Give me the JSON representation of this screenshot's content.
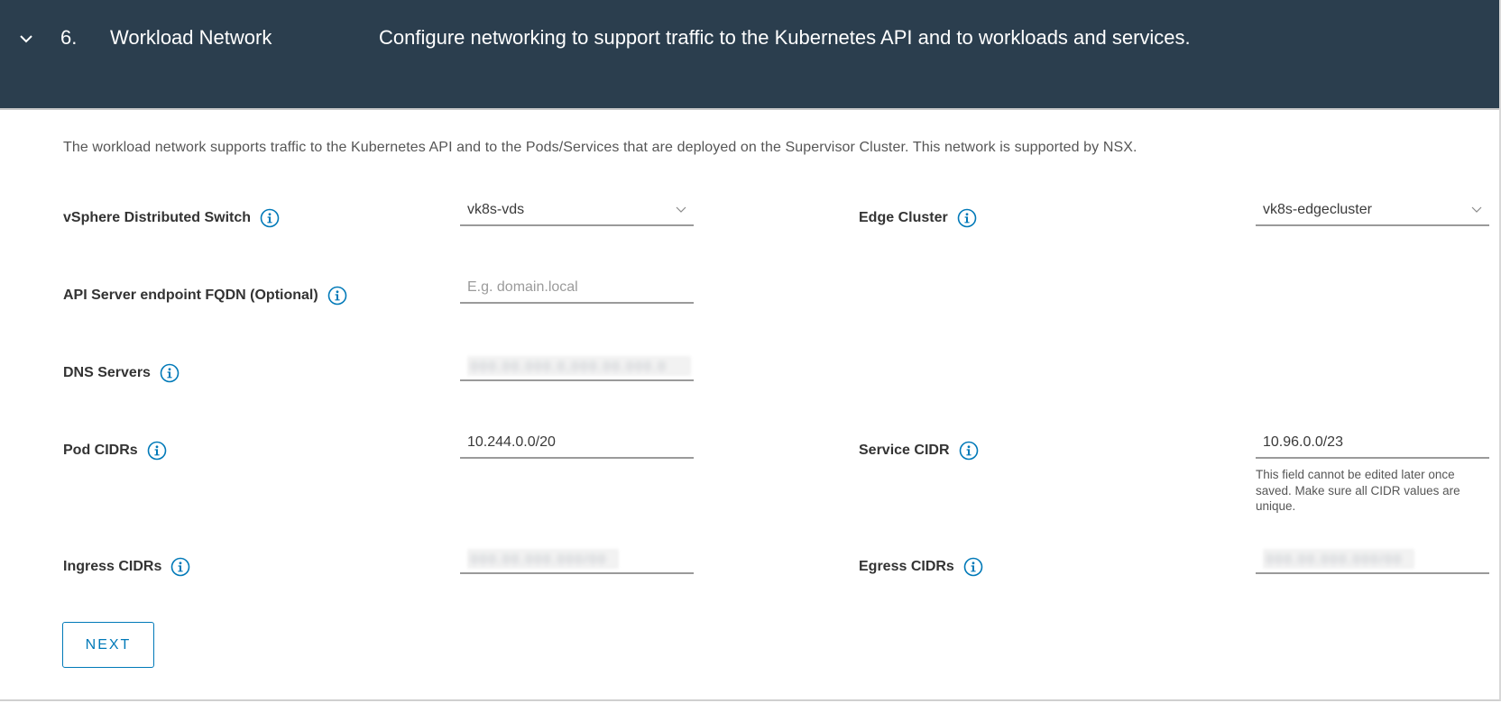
{
  "header": {
    "step_number": "6.",
    "title": "Workload Network",
    "description": "Configure networking to support traffic to the Kubernetes API and to workloads and services.",
    "expanded_icon": "chevron-down-icon"
  },
  "intro": "The workload network supports traffic to the Kubernetes API and to the Pods/Services that are deployed on the Supervisor Cluster. This network is supported by NSX.",
  "fields": {
    "vds": {
      "label": "vSphere Distributed Switch",
      "value": "vk8s-vds",
      "type": "select"
    },
    "edge_cluster": {
      "label": "Edge Cluster",
      "value": "vk8s-edgecluster",
      "type": "select"
    },
    "api_fqdn": {
      "label": "API Server endpoint FQDN (Optional)",
      "value": "",
      "placeholder": "E.g. domain.local",
      "type": "text"
    },
    "dns": {
      "label": "DNS Servers",
      "value": "[redacted]",
      "type": "text",
      "redacted": true
    },
    "pod_cidrs": {
      "label": "Pod CIDRs",
      "value": "10.244.0.0/20",
      "type": "text"
    },
    "service_cidr": {
      "label": "Service CIDR",
      "value": "10.96.0.0/23",
      "type": "text",
      "helper": "This field cannot be edited later once saved. Make sure all CIDR values are unique."
    },
    "ingress_cidrs": {
      "label": "Ingress CIDRs",
      "value": "[redacted]",
      "type": "text",
      "redacted": true
    },
    "egress_cidrs": {
      "label": "Egress CIDRs",
      "value": "[redacted]",
      "type": "text",
      "redacted": true
    }
  },
  "blur_placeholders": {
    "dns": "000.00.000.0,000.00.000.0",
    "ingress": "000.00.000.000/00",
    "egress": "000.00.000.000/00"
  },
  "actions": {
    "next_label": "NEXT"
  },
  "colors": {
    "header_bg": "#2b3e4e",
    "accent": "#0079b8",
    "label": "#333333",
    "muted": "#565656"
  }
}
